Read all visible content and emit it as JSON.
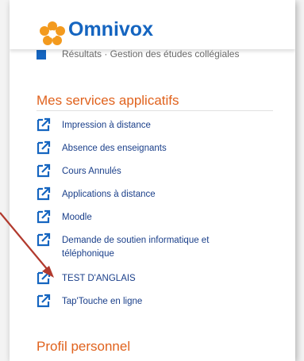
{
  "header": {
    "brand": "Omnivox"
  },
  "clipped_link": {
    "text": "Résultats · Gestion des études collégiales"
  },
  "services": {
    "title": "Mes services applicatifs",
    "items": [
      {
        "label": "Impression à distance"
      },
      {
        "label": "Absence des enseignants"
      },
      {
        "label": "Cours Annulés"
      },
      {
        "label": "Applications à distance"
      },
      {
        "label": "Moodle"
      },
      {
        "label": "Demande de soutien informatique et téléphonique"
      },
      {
        "label": "TEST D'ANGLAIS"
      },
      {
        "label": "Tap'Touche en ligne"
      }
    ]
  },
  "profile": {
    "title": "Profil personnel"
  },
  "colors": {
    "brand_blue": "#1565c0",
    "section_orange": "#e0621d",
    "logo_orange": "#f39a1e",
    "arrow_red": "#b23a2e"
  }
}
